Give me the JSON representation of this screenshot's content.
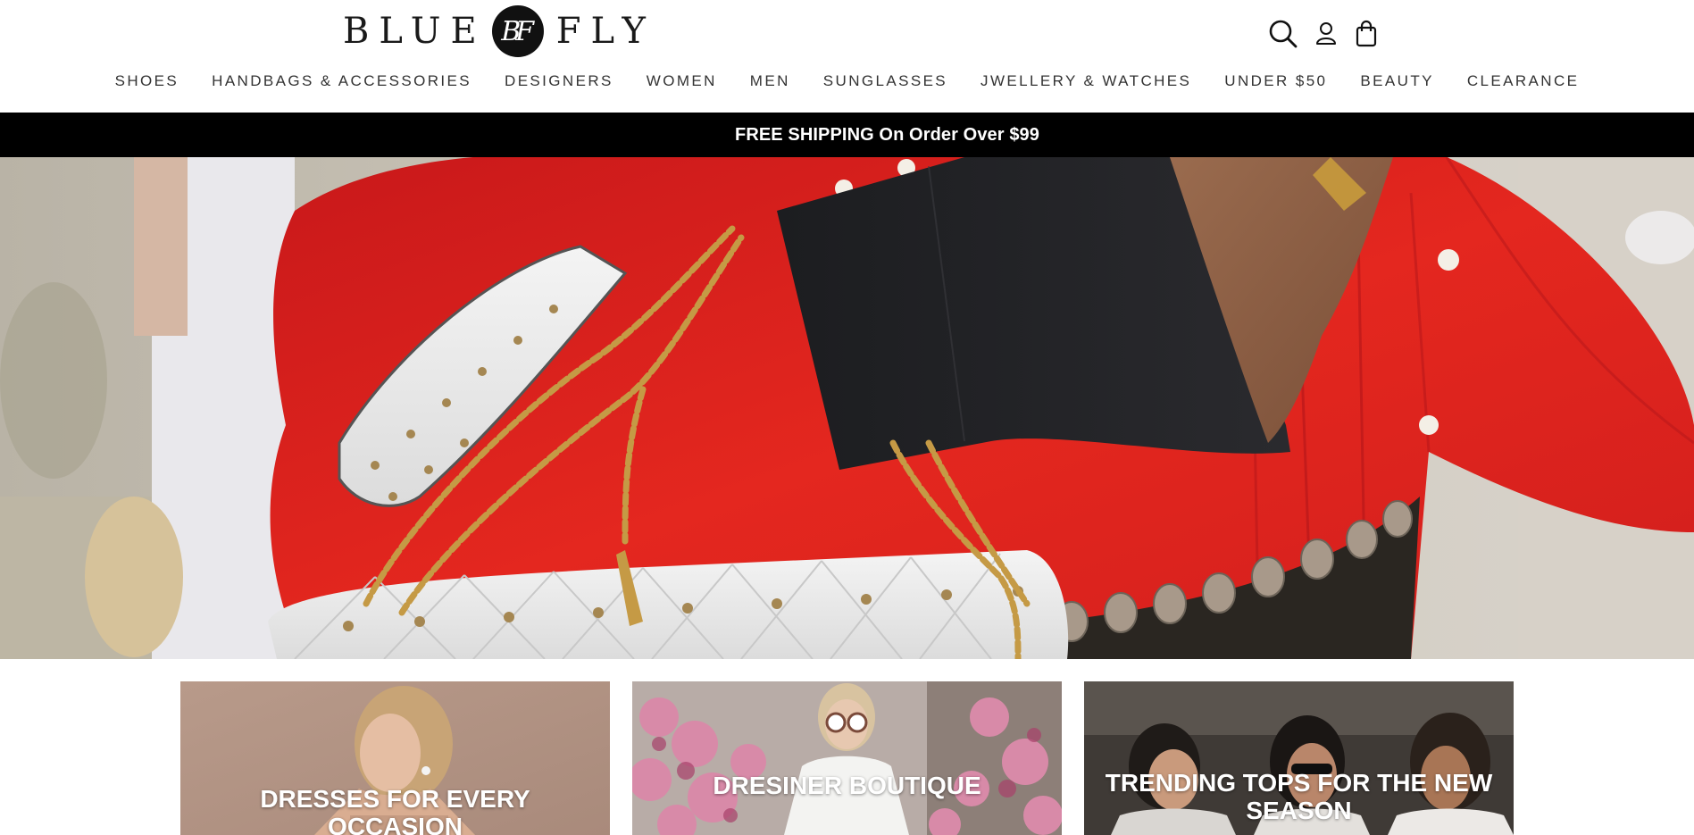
{
  "header": {
    "logo": {
      "left": "BLUE",
      "mark": "BF",
      "right": "FLY"
    },
    "icons": [
      "search-icon",
      "account-icon",
      "shopping-bag-icon"
    ]
  },
  "nav": {
    "items": [
      "SHOES",
      "HANDBAGS & ACCESSORIES",
      "DESIGNERS",
      "WOMEN",
      "MEN",
      "SUNGLASSES",
      "JWELLERY & WATCHES",
      "UNDER $50",
      "BEAUTY",
      "CLEARANCE"
    ]
  },
  "promo": {
    "text": "FREE SHIPPING On Order Over $99"
  },
  "categories": {
    "items": [
      "DRESSES FOR EVERY OCCASION",
      "DRESINER BOUTIQUE",
      "TRENDING TOPS FOR THE NEW SEASON"
    ]
  },
  "colors": {
    "promo_bg": "#000000",
    "hero_red": "#d9201e",
    "tile1_bg": "#b89a8a"
  }
}
